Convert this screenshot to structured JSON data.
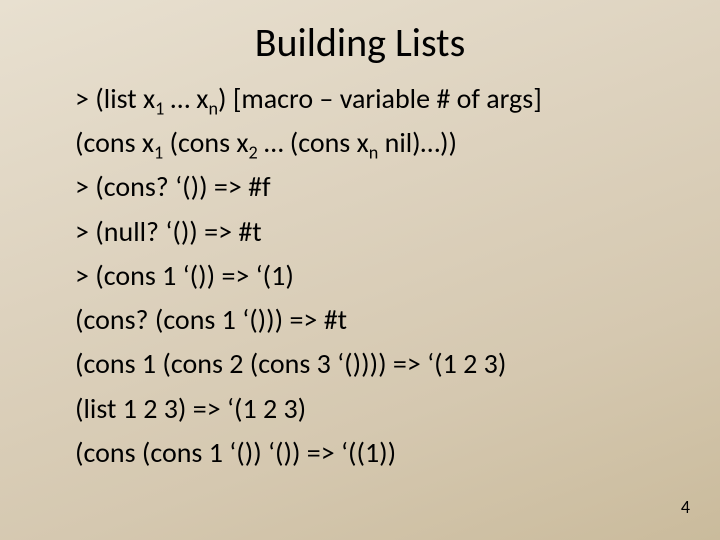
{
  "title": "Building Lists",
  "lines": {
    "l1a": "> (list x",
    "l1sub1": "1",
    "l1b": " … x",
    "l1sub2": "n",
    "l1c": ")  [macro – variable # of args]",
    "l2a": "   (cons x",
    "l2sub1": "1",
    "l2b": " (cons x",
    "l2sub2": "2",
    "l2c": " … (cons x",
    "l2sub3": "n",
    "l2d": " nil)…))",
    "l3": "> (cons? ‘()) => #f",
    "l4": "> (null? ‘()) => #t",
    "l5": "> (cons 1 ‘()) => ‘(1)",
    "l6": "(cons? (cons 1 ‘())) => #t",
    "l7": "(cons 1 (cons 2 (cons 3 ‘()))) => ‘(1 2 3)",
    "l8": "(list 1 2 3) => ‘(1 2 3)",
    "l9": "(cons (cons 1 ‘()) ‘()) => ‘((1))"
  },
  "page_number": "4"
}
